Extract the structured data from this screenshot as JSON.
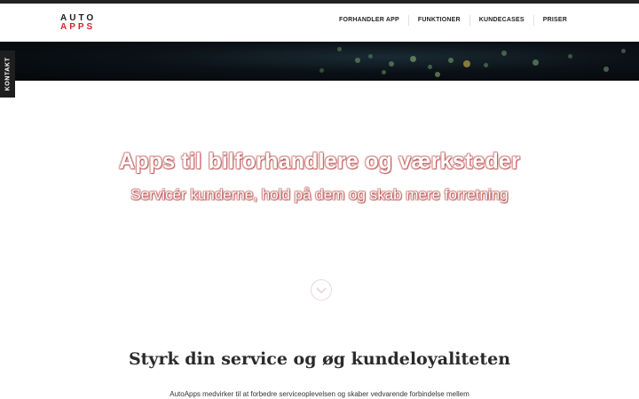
{
  "logo": {
    "line1": "AUTO",
    "line2": "APPS"
  },
  "nav": {
    "items": [
      {
        "label": "FORHANDLER APP"
      },
      {
        "label": "FUNKTIONER"
      },
      {
        "label": "KUNDECASES"
      },
      {
        "label": "PRISER"
      }
    ]
  },
  "contact_tab": {
    "label": "KONTAKT"
  },
  "hero": {
    "title": "Apps til bilforhandlere og værksteder",
    "subtitle": "Servicér kunderne, hold på dem og skab mere forretning",
    "scroll_icon": "chevron-down-icon"
  },
  "section": {
    "title": "Styrk din service og øg kundeloyaliteten",
    "text": "AutoApps medvirker til at forbedre serviceoplevelsen og skaber vedvarende forbindelse mellem"
  },
  "colors": {
    "brand_red": "#d2232a",
    "dark": "#1e1e1e"
  }
}
